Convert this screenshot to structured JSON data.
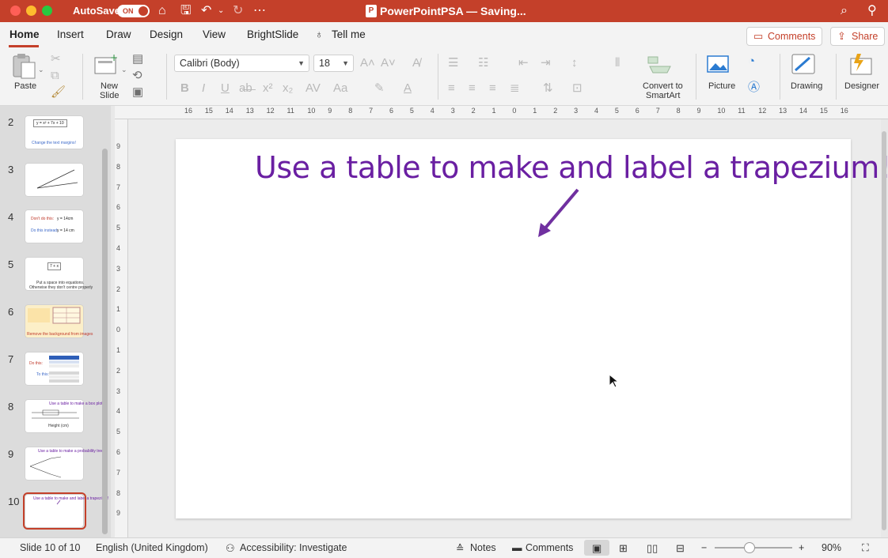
{
  "window": {
    "autosave_label": "AutoSave",
    "autosave_state": "ON",
    "title": "PowerPointPSA — Saving...",
    "app_logo": "P",
    "traffic_colors": [
      "#fe5f57",
      "#febc2e",
      "#28c840"
    ]
  },
  "menu": {
    "tabs": [
      "Home",
      "Insert",
      "Draw",
      "Design",
      "View",
      "BrightSlide"
    ],
    "tell_me": "Tell me",
    "comments_button": "Comments",
    "share_button": "Share"
  },
  "ribbon": {
    "paste": "Paste",
    "new_slide_line1": "New",
    "new_slide_line2": "Slide",
    "font_name": "Calibri (Body)",
    "font_size": "18",
    "convert_line1": "Convert to",
    "convert_line2": "SmartArt",
    "picture": "Picture",
    "drawing": "Drawing",
    "designer": "Designer"
  },
  "slides": {
    "numbers": [
      "2",
      "3",
      "4",
      "5",
      "6",
      "7",
      "8",
      "9",
      "10"
    ],
    "thumb2_eq": "y = x² + 7x + 10",
    "thumb2_caption": "Change the text margins!",
    "thumb4_line1": "Don't do this:",
    "thumb4_eq1": "y = 14cm",
    "thumb4_line2": "Do this instead:",
    "thumb4_eq2": "y = 14 cm",
    "thumb5_box": "7 + x",
    "thumb5_caption1": "Put a space into equations.",
    "thumb5_caption2": "Otherwise they don't centre properly",
    "thumb6_caption": "Remove the background from images",
    "thumb7_line1": "Do this:",
    "thumb7_line2": "To this:",
    "thumb8_caption": "Use a table to make a box plot",
    "thumb8_axis": "Height (cm)",
    "thumb9_caption": "Use a table to make a probability tree",
    "thumb10_caption": "Use a table to make and label a trapezium!",
    "current_index": 10
  },
  "ruler": {
    "top_labels": [
      "16",
      "15",
      "14",
      "13",
      "12",
      "11",
      "10",
      "9",
      "8",
      "7",
      "6",
      "5",
      "4",
      "3",
      "2",
      "1",
      "0",
      "1",
      "2",
      "3",
      "4",
      "5",
      "6",
      "7",
      "8",
      "9",
      "10",
      "11",
      "12",
      "13",
      "14",
      "15",
      "16"
    ],
    "left_labels": [
      "9",
      "8",
      "7",
      "6",
      "5",
      "4",
      "3",
      "2",
      "1",
      "0",
      "1",
      "2",
      "3",
      "4",
      "5",
      "6",
      "7",
      "8",
      "9"
    ]
  },
  "slide": {
    "title": "Use a table to make and label a trapezium!",
    "title_color": "#6a1fa2",
    "arrow_color": "#7030a0"
  },
  "status": {
    "slide_info": "Slide 10 of 10",
    "language": "English (United Kingdom)",
    "accessibility": "Accessibility: Investigate",
    "notes": "Notes",
    "comments": "Comments",
    "zoom": "90%"
  }
}
